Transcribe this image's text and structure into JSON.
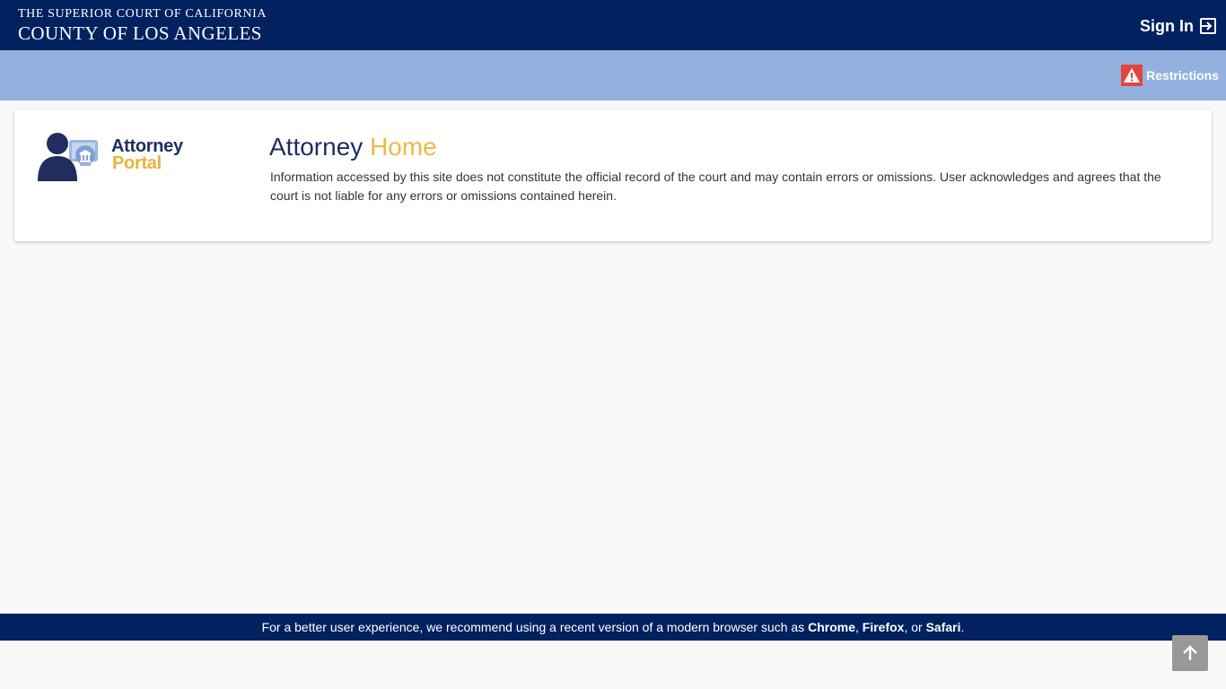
{
  "header": {
    "court_line1": "THE SUPERIOR COURT OF CALIFORNIA",
    "court_line2": "COUNTY OF LOS ANGELES",
    "sign_in_label": "Sign In",
    "sign_in_icon": "sign-in-icon"
  },
  "subheader": {
    "restrictions_label": "Restrictions",
    "restrictions_icon": "warning-icon"
  },
  "card": {
    "logo_line1": "Attorney",
    "logo_line2": "Portal",
    "heading_part1": "Attorney",
    "heading_part2": "Home",
    "description": "Information accessed by this site does not constitute the official record of the court and may contain errors or omissions. User acknowledges and agrees that the court is not liable for any errors or omissions contained herein."
  },
  "footer": {
    "text_before": "For a better user experience, we recommend using a recent version of a modern browser such as",
    "browser1": "Chrome",
    "sep1": ",",
    "browser2": "Firefox",
    "sep2": ", or",
    "browser3": "Safari",
    "end": "."
  },
  "scroll_top": {
    "icon": "arrow-up-icon"
  },
  "colors": {
    "navy": "#01215f",
    "light_blue": "#93b1df",
    "gold": "#eab947",
    "warning_red": "#e2453c"
  }
}
